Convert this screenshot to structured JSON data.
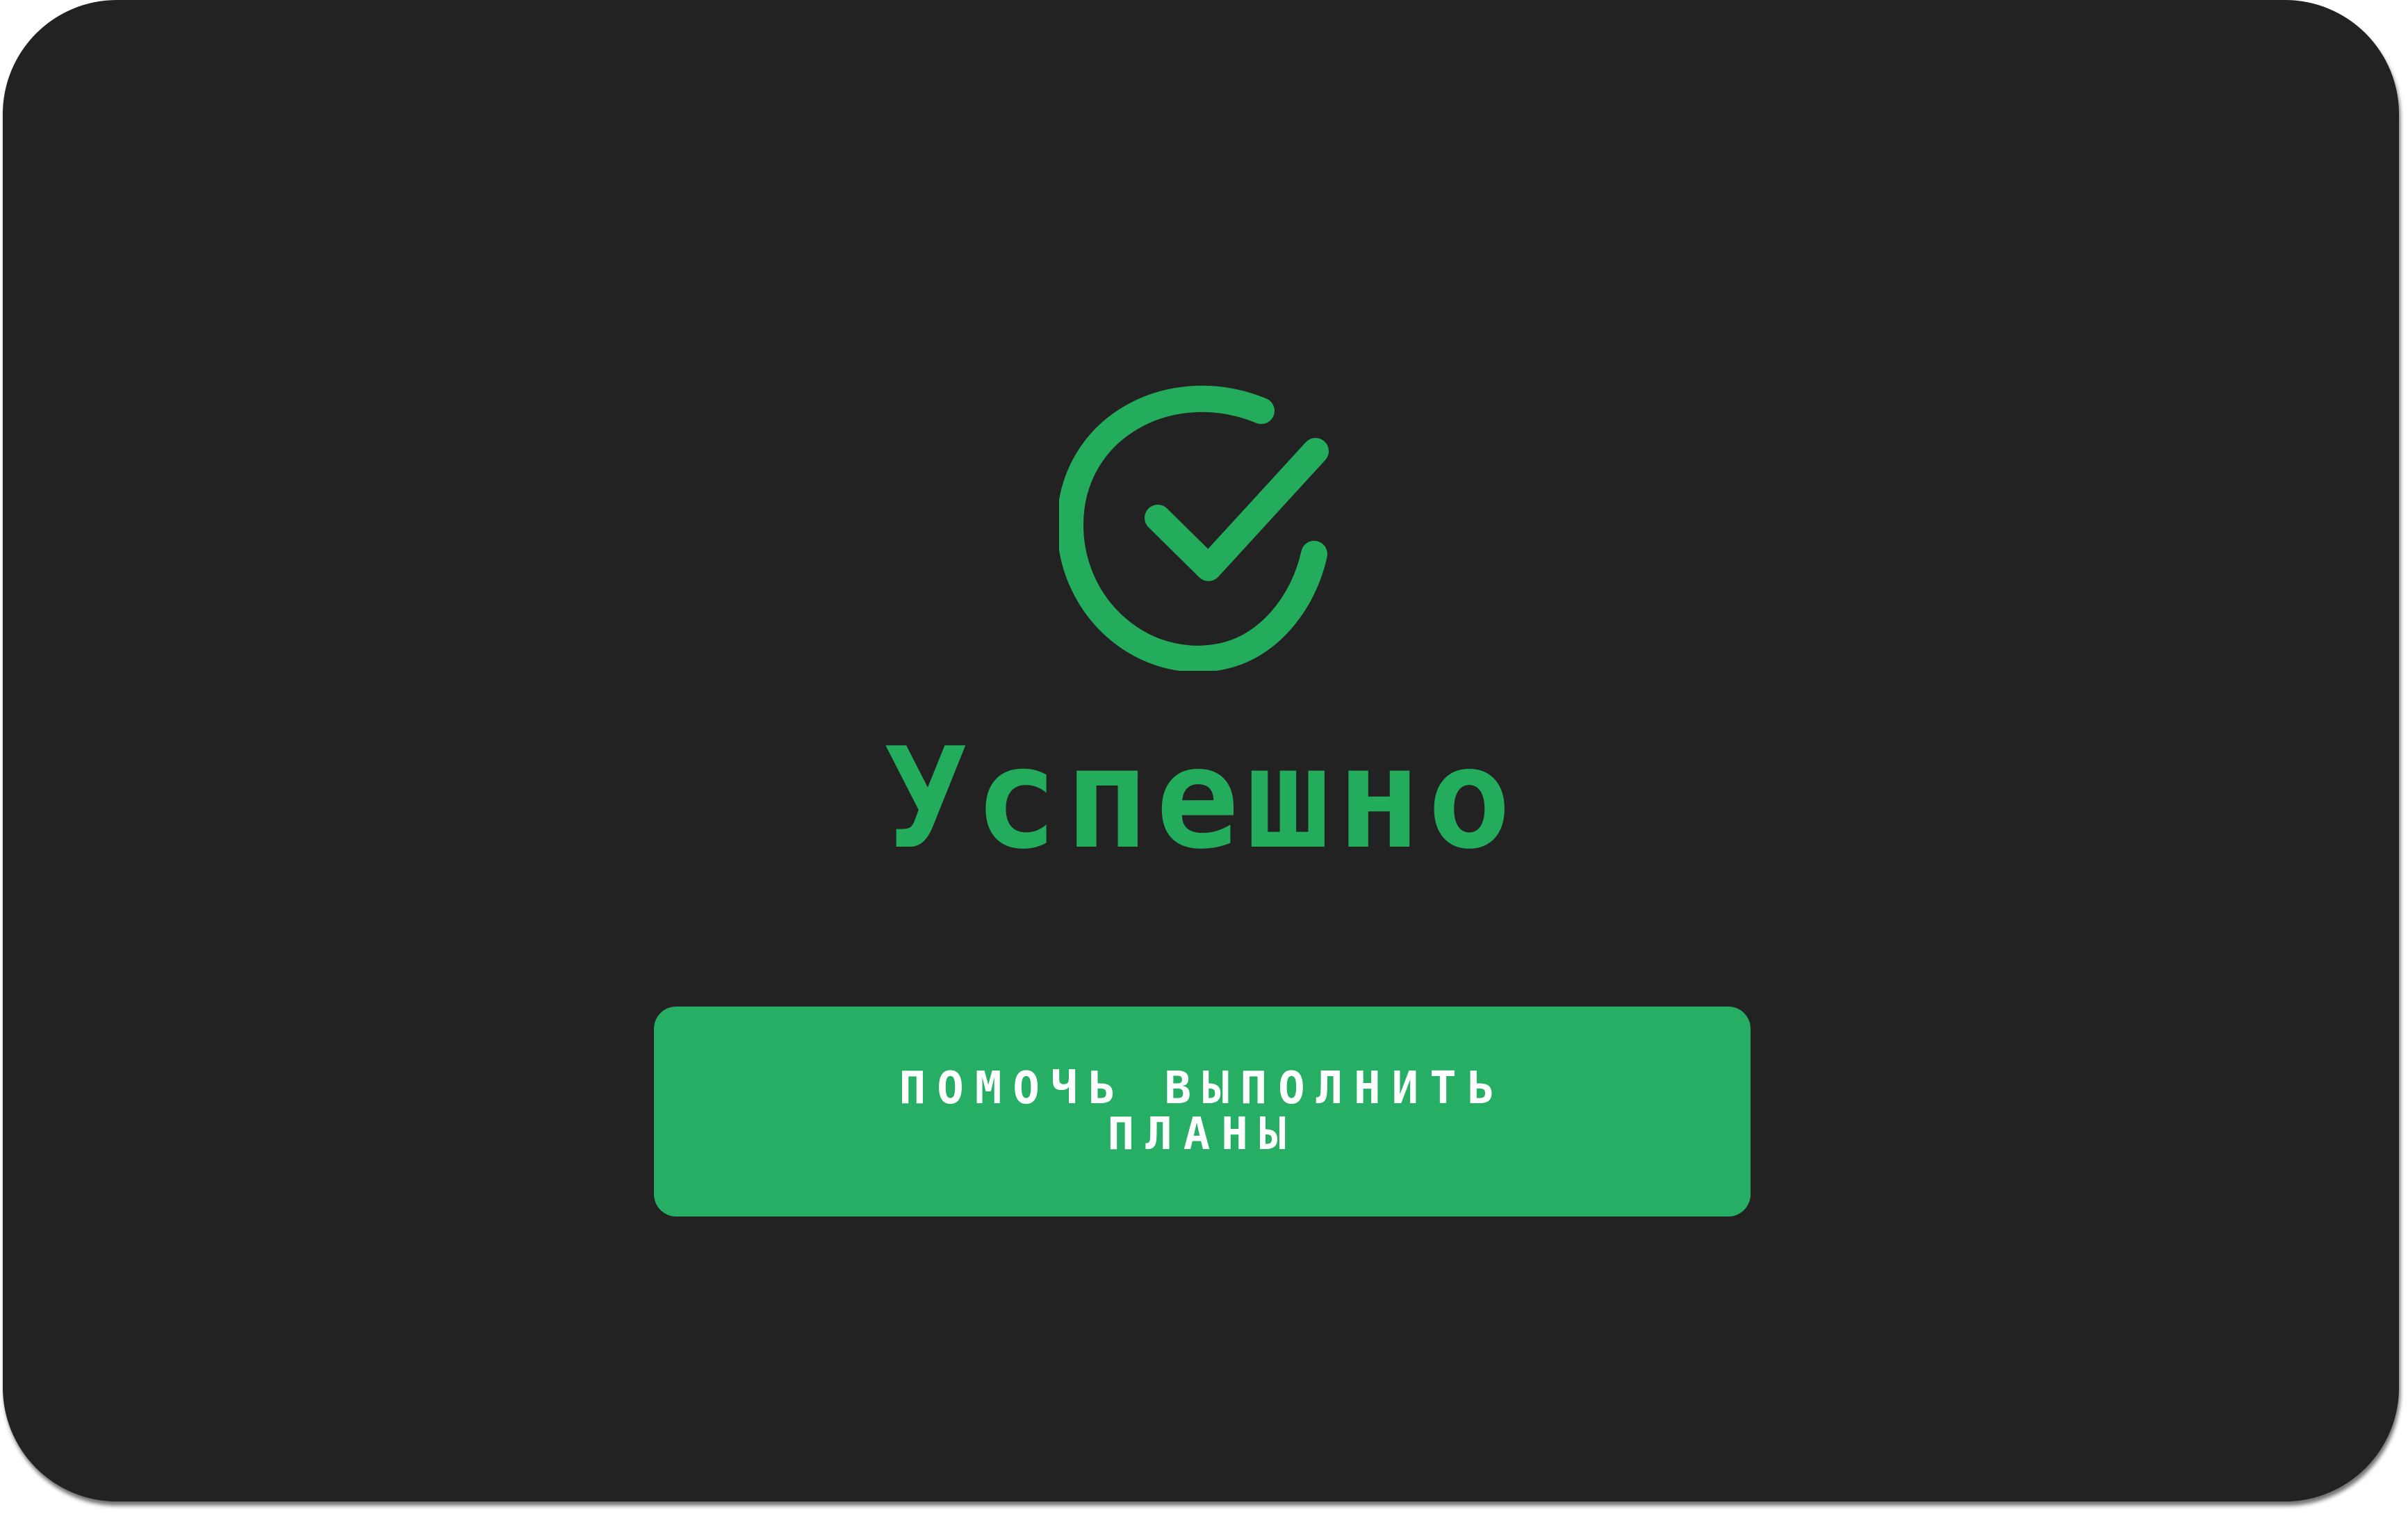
{
  "colors": {
    "card_background": "#222222",
    "accent_green": "#22ac5c",
    "button_background": "#27ae65",
    "button_text": "#ffffff"
  },
  "icon": "check-circle-icon",
  "status": {
    "title": "Успешно"
  },
  "action": {
    "label": "помочь выполнить планы"
  }
}
